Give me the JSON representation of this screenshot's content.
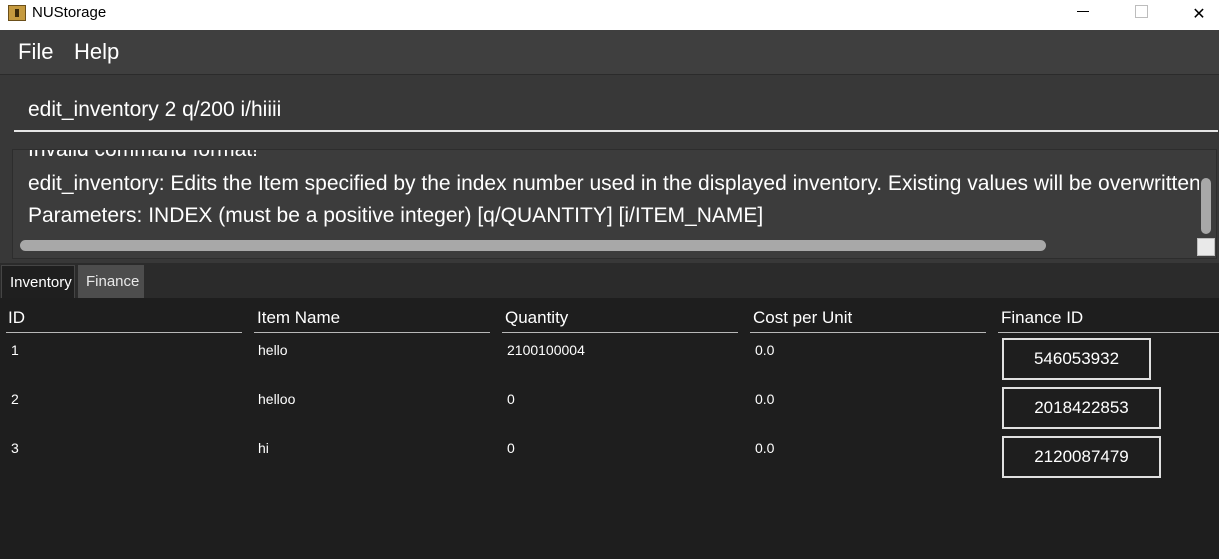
{
  "window": {
    "title": "NUStorage",
    "icons": {
      "app": "app-icon",
      "minimize": "minimize-icon",
      "maximize": "maximize-icon",
      "close": "close-icon"
    },
    "close_glyph": "✕"
  },
  "menu": {
    "file": "File",
    "help": "Help"
  },
  "command": {
    "value": "edit_inventory 2 q/200 i/hiiii"
  },
  "result": {
    "lines": [
      "Invalid command format!",
      "edit_inventory: Edits the Item specified by the index number used in the displayed inventory. Existing values will be overwritten by",
      "Parameters: INDEX (must be a positive integer) [q/QUANTITY] [i/ITEM_NAME]"
    ]
  },
  "tabs": [
    {
      "label": "Inventory",
      "selected": true
    },
    {
      "label": "Finance",
      "selected": false
    }
  ],
  "table": {
    "columns": [
      "ID",
      "Item Name",
      "Quantity",
      "Cost per Unit",
      "Finance ID"
    ],
    "rows": [
      {
        "id": "1",
        "name": "hello",
        "quantity": "2100100004",
        "cost": "0.0",
        "finance_id": "546053932"
      },
      {
        "id": "2",
        "name": "helloo",
        "quantity": "0",
        "cost": "0.0",
        "finance_id": "2018422853"
      },
      {
        "id": "3",
        "name": "hi",
        "quantity": "0",
        "cost": "0.0",
        "finance_id": "2120087479"
      }
    ]
  },
  "colors": {
    "background": "#1e1e1e",
    "menubar": "#3f3f3f",
    "panel": "#383838",
    "text": "#ffffff"
  }
}
